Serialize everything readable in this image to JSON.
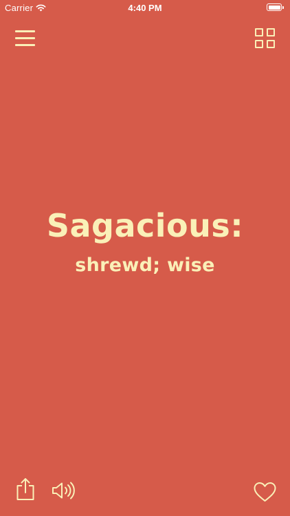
{
  "status_bar": {
    "carrier": "Carrier",
    "time": "4:40 PM",
    "wifi_icon": "wifi-icon",
    "battery_icon": "battery-icon"
  },
  "header": {
    "menu_icon": "hamburger-menu-icon",
    "grid_icon": "grid-view-icon"
  },
  "word": {
    "term": "Sagacious:",
    "definition": "shrewd; wise"
  },
  "toolbar": {
    "share_icon": "share-icon",
    "sound_icon": "speaker-icon",
    "favorite_icon": "heart-icon"
  },
  "colors": {
    "background": "#D65B4A",
    "foreground": "#FAF0B8",
    "status_text": "#FFFFFF"
  }
}
